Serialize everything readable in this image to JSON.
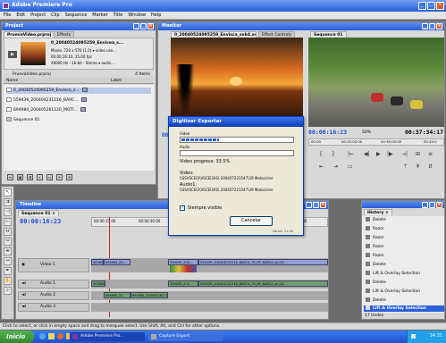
{
  "app": {
    "title": "Adobe Premiere Pro"
  },
  "menubar": [
    "File",
    "Edit",
    "Project",
    "Clip",
    "Sequence",
    "Marker",
    "Title",
    "Window",
    "Help"
  ],
  "project": {
    "title": "Project",
    "tabs": [
      "PruevaVideo.prproj",
      "Effects"
    ],
    "preview": {
      "name": "0_20040524095259_Envicea_s...",
      "line1": "Movie, 720 x 576 (1.0) ▾ video use...",
      "line2": "00:00:16:10, 25.00 fps",
      "line3": "48000 Hz - 16-bit - Stereo ▾ audio ..."
    },
    "bin_name": "PruevaVideo.prproj",
    "items_count": "4 Items",
    "col_name": "Name",
    "col_label": "Label",
    "items": [
      "0_20040524095259_Envisca_s...",
      "559439_200404231216_BARC...",
      "694984_200405261120_MOTI...",
      "Sequence 01"
    ],
    "toolbar_icons": [
      "list-view-icon",
      "icon-view-icon",
      "automate-icon",
      "find-icon",
      "new-bin-icon",
      "new-item-icon",
      "clear-icon"
    ]
  },
  "monitor": {
    "title": "Monitor",
    "source_tab": "0_20040524095259_Envisca_sob4.avi",
    "effect_tab": "Effect Controls",
    "source_timecode": "00:00",
    "seq_tab": "Sequence 01",
    "seq_timecode": "00:00:16:23",
    "zoom": "50%",
    "duration": "00:37:34:17",
    "ruler": [
      "00:00",
      "00:15:00:00",
      "00:30:00:00",
      "00:45:0"
    ]
  },
  "timeline": {
    "title": "Timeline",
    "seq_tab": "Sequence 01",
    "timecode": "00:00:16:23",
    "ruler": [
      "00:00:15:00",
      "00:00:30:00",
      "00:00:00:00"
    ],
    "tracks": [
      {
        "name": "Video 1",
        "type": "video"
      },
      {
        "name": "Audio 1",
        "type": "audio"
      },
      {
        "name": "Audio 2",
        "type": "audio"
      },
      {
        "name": "Audio 3",
        "type": "audio"
      }
    ],
    "clips": {
      "v1a": "902606_2004...",
      "v1b": "694984_20...",
      "v1c": "559439_200...",
      "v1d": "559439_200404231216_BARCA_TV_RF_BARCA_ac [V]",
      "a1a": "902606_2",
      "a1b": "559439_200",
      "a1c": "559439_200404231216_BARCA_TV_RF_BARCA_ac [A]",
      "a2a": "694984_20",
      "a2b": "694984_2004052611120_M"
    }
  },
  "export": {
    "title": "Digitizar Exportar",
    "video_label": "Video",
    "audio_label": "Audio",
    "progress_label": "Video progress: 33.5%",
    "progress": 0.335,
    "video_path_label": "Video:",
    "video_path": "\\\\SSVSCEI3\\VSCEI3AS\\ 200407221547\\39 Motocicler",
    "audio_path_label": "Audio1:",
    "audio_path": "\\\\SSVSCEI3\\VSCEI3AS\\ 200407221547\\39 Motocicler",
    "checkbox_label": "Siempre visible",
    "checkbox_checked": true,
    "cancel_label": "Cancelar",
    "version": "Versió: 11.09"
  },
  "history": {
    "title": "History",
    "items": [
      "Delete",
      "Razor",
      "Razor",
      "Razor",
      "Razor",
      "Delete",
      "Lift & Overlay Selection",
      "Delete",
      "Lift & Overlay Selection",
      "Delete",
      "Lift & Overlay Selection"
    ],
    "selected_index": 10,
    "count": "17 Undos"
  },
  "status": {
    "text": "Click to select, or click in empty space and drag to marquee select. Use Shift, Alt, and Ctrl for other options."
  },
  "taskbar": {
    "start": "Inicio",
    "tasks": [
      "Adobe Premiere Pro...",
      "Capture Export"
    ],
    "clock": "14:31"
  },
  "colors": {
    "titlebar": "#2a5fd8",
    "timecode": "#1e4fd8",
    "progress": "#2a5fd8",
    "taskbar": "#245edb",
    "start": "#3c9a3c"
  }
}
